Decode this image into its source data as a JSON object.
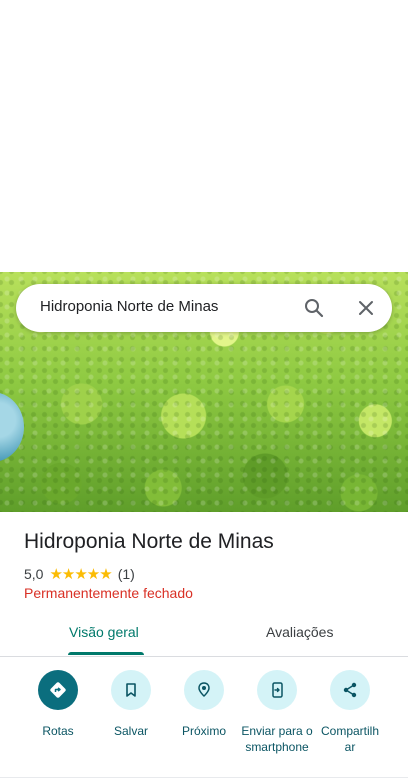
{
  "search": {
    "query": "Hidroponia Norte de Minas"
  },
  "place": {
    "name": "Hidroponia Norte de Minas",
    "rating": "5,0",
    "stars": "★★★★★",
    "review_count": "(1)",
    "status": "Permanentemente fechado"
  },
  "tabs": [
    {
      "label": "Visão geral",
      "selected": true
    },
    {
      "label": "Avaliações",
      "selected": false
    }
  ],
  "actions": [
    {
      "label": "Rotas",
      "icon": "directions-icon"
    },
    {
      "label": "Salvar",
      "icon": "bookmark-icon"
    },
    {
      "label": "Próximo",
      "icon": "nearby-icon"
    },
    {
      "label": "Enviar para o smartphone",
      "icon": "send-to-phone-icon"
    },
    {
      "label": "Compartilhar",
      "icon": "share-icon"
    }
  ],
  "colors": {
    "accent": "#00796b",
    "primary_button": "#0b6e7e",
    "action_bg": "#d4f3f7",
    "closed_status": "#d93025",
    "star": "#fbbc04"
  }
}
